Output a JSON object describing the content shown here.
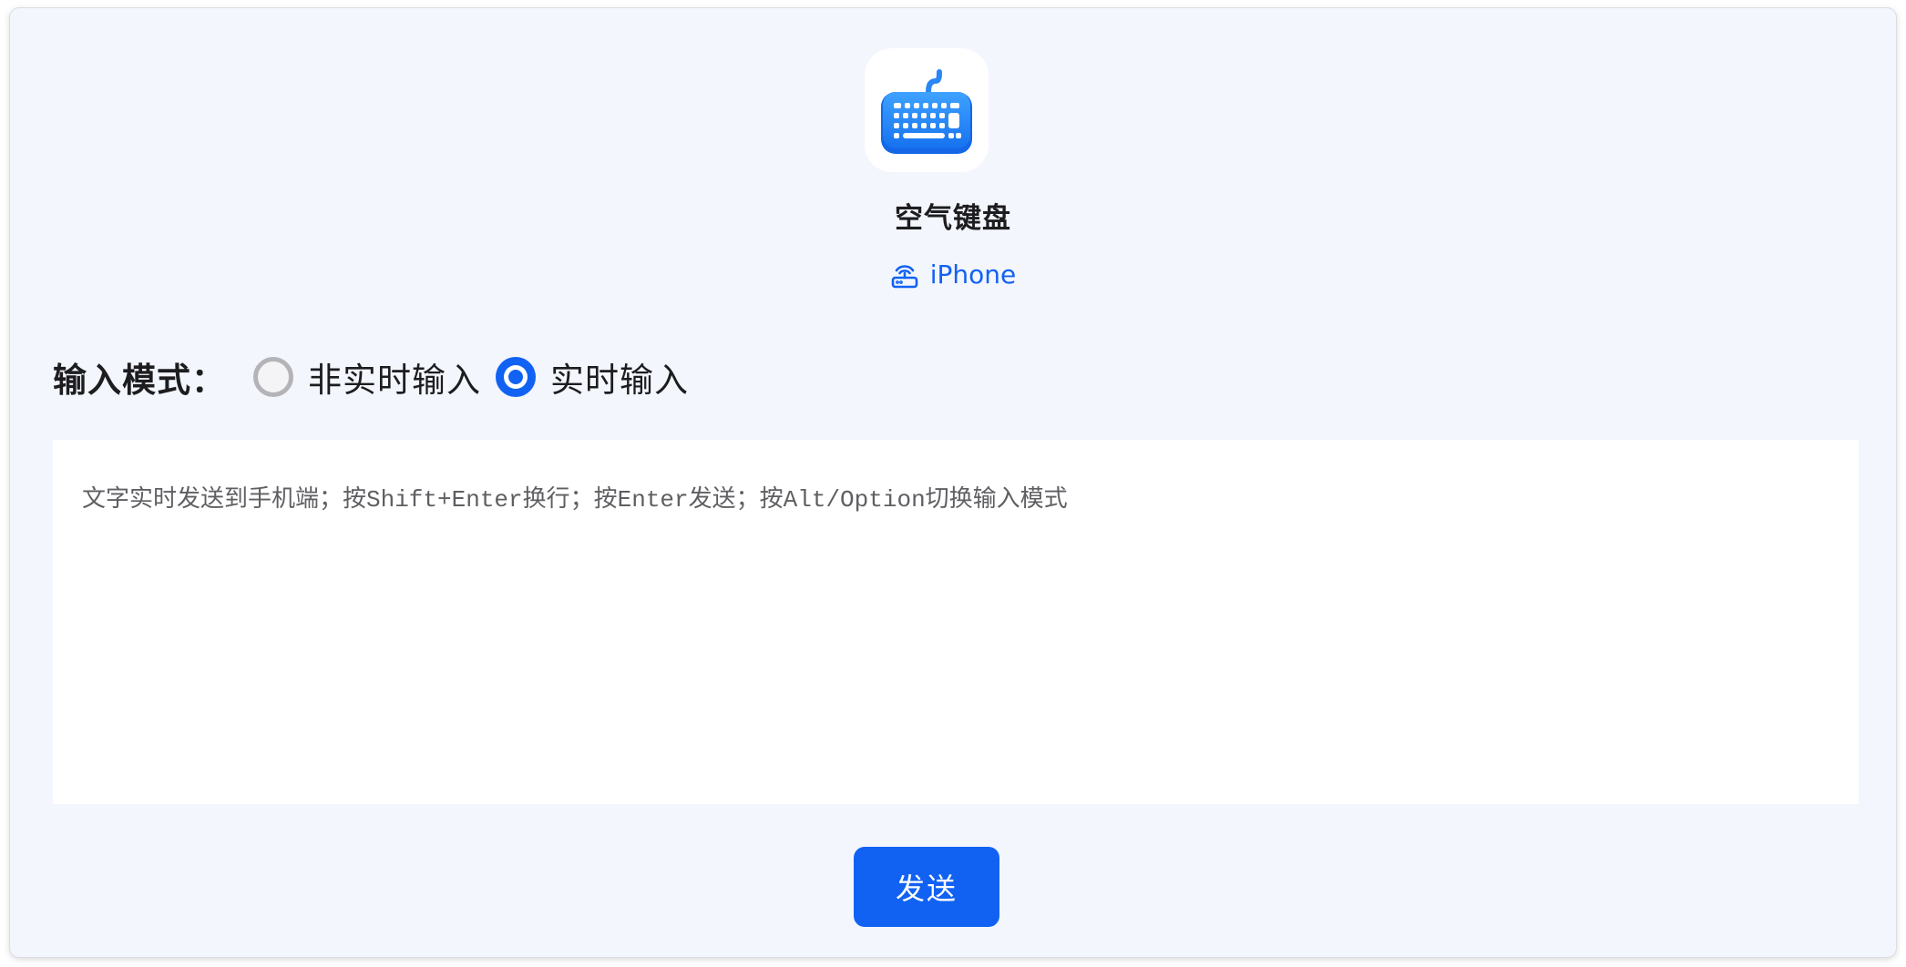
{
  "app": {
    "name": "空气键盘",
    "icon": "keyboard-app-icon",
    "accent_color": "#1162f3"
  },
  "device": {
    "icon": "router-icon",
    "name": "iPhone"
  },
  "input_mode": {
    "label": "输入模式：",
    "options": [
      {
        "label": "非实时输入",
        "selected": false
      },
      {
        "label": "实时输入",
        "selected": true
      }
    ]
  },
  "editor": {
    "value": "",
    "placeholder": "文字实时发送到手机端；按Shift+Enter换行；按Enter发送；按Alt/Option切换输入模式"
  },
  "actions": {
    "send_label": "发送"
  }
}
